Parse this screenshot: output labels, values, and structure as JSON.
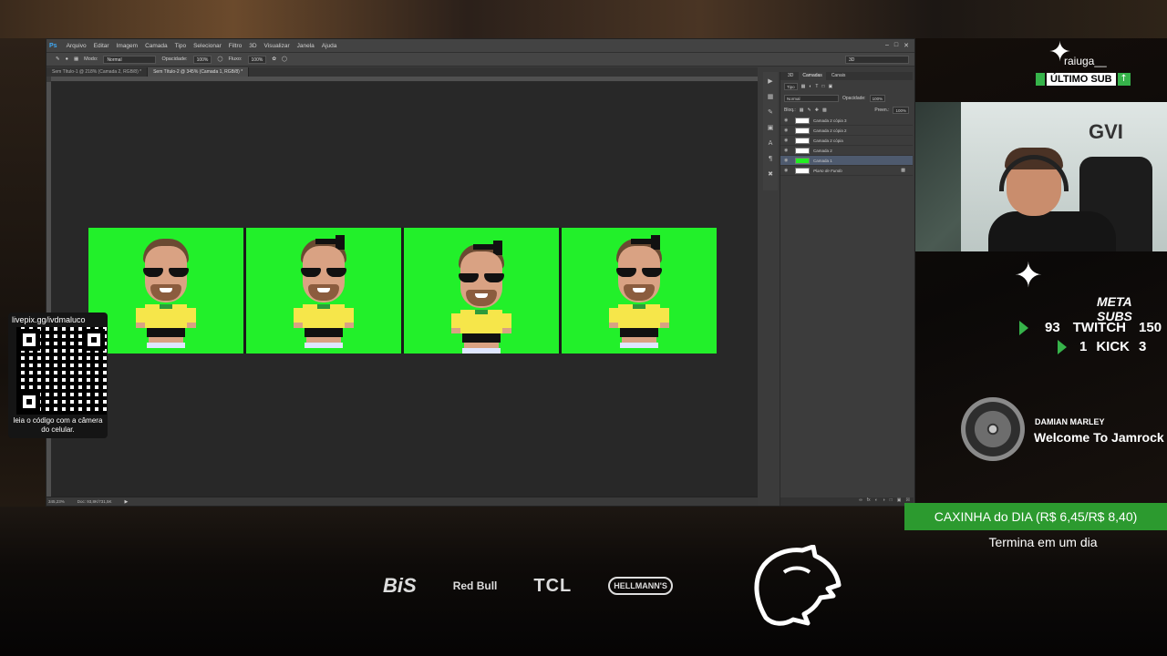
{
  "photoshop": {
    "logo": "Ps",
    "menu": [
      "Arquivo",
      "Editar",
      "Imagem",
      "Camada",
      "Tipo",
      "Selecionar",
      "Filtro",
      "3D",
      "Visualizar",
      "Janela",
      "Ajuda"
    ],
    "options": {
      "mode_label": "Modo:",
      "mode_value": "Normal",
      "opacity_label": "Opacidade:",
      "opacity_value": "100%",
      "flow_label": "Fluxo:",
      "flow_value": "100%",
      "workspace": "3D"
    },
    "tabs": [
      "Sem Título-1 @ 218% (Camada 2, RGB/8) *",
      "Sem Título-2 @ 345% (Camada 1, RGB/8) *"
    ],
    "status": {
      "zoom": "345,23%",
      "doc": "Doc: 93,8K/731,5K"
    },
    "layers_panel": {
      "tabs": [
        "3D",
        "Camadas",
        "Canais"
      ],
      "filter": "Tipo",
      "blend_mode": "Normal",
      "opacity_label": "Opacidade:",
      "opacity_value": "100%",
      "lock_label": "Bloq.:",
      "fill_label": "Preen.:",
      "fill_value": "100%",
      "layers": [
        "Camada 2 cópia 3",
        "Camada 2 cópia 2",
        "Camada 2 cópia",
        "Camada 2",
        "Camada 1",
        "Plano de Fundo"
      ]
    }
  },
  "qr": {
    "url": "livepix.gg/ivdmaluco",
    "caption": "leia o código com a câmera do celular."
  },
  "overlay": {
    "last_sub_name": "raiuga__",
    "last_sub_label": "ÚLTIMO SUB",
    "meta_subs": "META SUBS",
    "twitch": {
      "current": "93",
      "label": "TWITCH",
      "goal": "150"
    },
    "kick": {
      "current": "1",
      "label": "KICK",
      "goal": "3"
    },
    "music": {
      "artist": "DAMIAN MARLEY",
      "track": "Welcome To Jamrock"
    },
    "caxinha": {
      "title": "CAXINHA do DIA (R$ 6,45/R$ 8,40)",
      "subtitle": "Termina em um dia"
    },
    "sponsors": [
      "BiS",
      "Red Bull",
      "TCL",
      "HELLMANN'S"
    ],
    "webcam_logo": "GVI"
  },
  "colors": {
    "chroma_green": "#22f02a",
    "accent_green": "#2c9a2f",
    "ps_blue": "#3fa9f5"
  }
}
